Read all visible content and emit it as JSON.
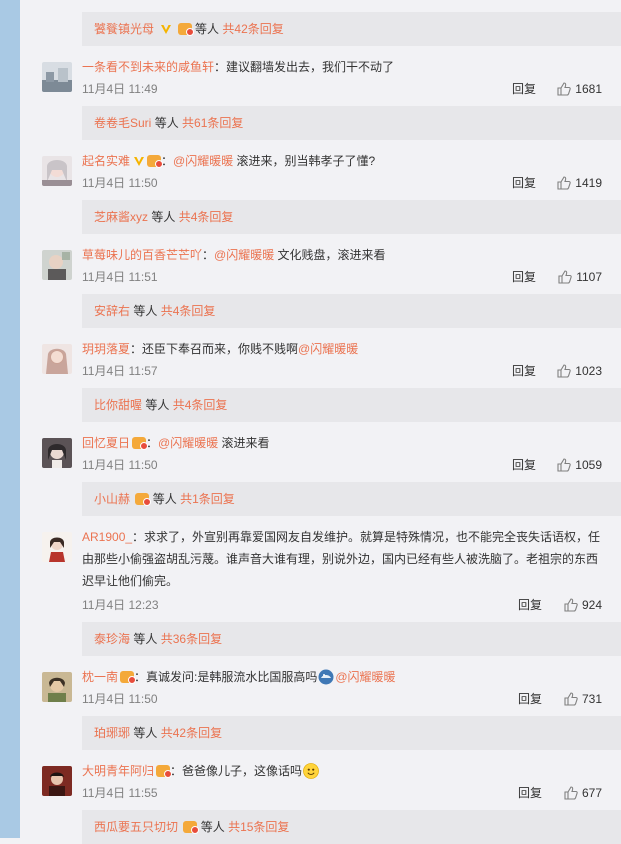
{
  "reply_label": "回复",
  "colors": {
    "link": "#eb7350",
    "reply_bg": "#e7e7ea",
    "side": "#a9c9e4"
  },
  "top_reply_box": {
    "name": "饕餮镇光母",
    "suffix": "等人",
    "count": "共42条回复"
  },
  "comments": [
    {
      "user": "一条看不到未来的咸鱼轩",
      "text": "：建议翻墙发出去，我们干不动了",
      "time": "11月4日 11:49",
      "likes": "1681",
      "reply_box": {
        "name": "卷卷毛Suri",
        "suffix": "等人",
        "count": "共61条回复"
      }
    },
    {
      "user": "起名实难",
      "mention": "@闪耀暖暖",
      "text": " 滚进来，别当韩孝子了懂?",
      "time": "11月4日 11:50",
      "likes": "1419",
      "reply_box": {
        "name": "芝麻酱xyz",
        "suffix": "等人",
        "count": "共4条回复"
      }
    },
    {
      "user": "草莓味儿的百香芒芒吖",
      "mention": "@闪耀暖暖",
      "text": " 文化贱盘，滚进来看",
      "time": "11月4日 11:51",
      "likes": "1107",
      "reply_box": {
        "name": "安辞右",
        "suffix": "等人",
        "count": "共4条回复"
      }
    },
    {
      "user": "玥玥落夏",
      "text": "：还臣下奉召而来，你贱不贱啊",
      "mention": "@闪耀暖暖",
      "time": "11月4日 11:57",
      "likes": "1023",
      "reply_box": {
        "name": "比你甜喔",
        "suffix": "等人",
        "count": "共4条回复"
      }
    },
    {
      "user": "回忆夏日",
      "mention": "@闪耀暖暖",
      "text": " 滚进来看",
      "time": "11月4日 11:50",
      "likes": "1059",
      "reply_box": {
        "name": "小山赫",
        "suffix": "等人",
        "count": "共1条回复"
      }
    },
    {
      "user": "AR1900_",
      "text_lines": [
        "：求求了，外宣别再靠爱国网友自发维护。就算是特殊情况，也不能完全丧失话语权，任",
        "由那些小偷强盗胡乱污蔑。谁声音大谁有理，别说外边，国内已经有些人被洗脑了。老祖宗的东西",
        "迟早让他们偷完。"
      ],
      "time": "11月4日 12:23",
      "likes": "924",
      "reply_box": {
        "name": "泰珍海",
        "suffix": "等人",
        "count": "共36条回复"
      }
    },
    {
      "user": "枕一南",
      "text": "：真诚发问:是韩服流水比国服高吗",
      "mention": "@闪耀暖暖",
      "time": "11月4日 11:50",
      "likes": "731",
      "reply_box": {
        "name": "珀琊琊",
        "suffix": "等人",
        "count": "共42条回复"
      }
    },
    {
      "user": "大明青年阿归",
      "text": "：爸爸像儿子，这像话吗",
      "time": "11月4日 11:55",
      "likes": "677",
      "reply_box": {
        "name": "西瓜要五只切切",
        "suffix": "等人",
        "count": "共15条回复"
      }
    }
  ]
}
